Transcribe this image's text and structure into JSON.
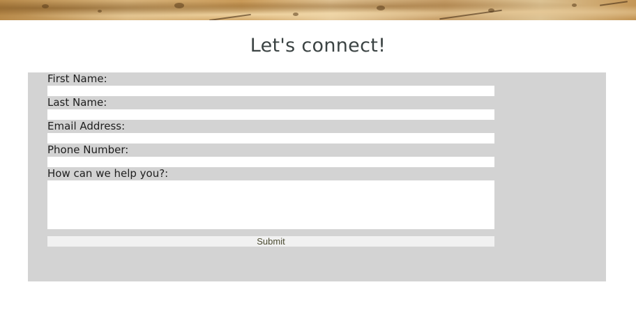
{
  "page": {
    "title": "Let's connect!"
  },
  "form": {
    "first_name_label": "First Name:",
    "first_name_value": "",
    "last_name_label": "Last Name:",
    "last_name_value": "",
    "email_label": "Email Address:",
    "email_value": "",
    "phone_label": "Phone Number:",
    "phone_value": "",
    "message_label": "How can we help you?:",
    "message_value": "",
    "submit_label": "Submit"
  },
  "colors": {
    "panel_background": "#d3d3d3",
    "title_text": "#3b4343",
    "input_background": "#ffffff",
    "submit_background": "#f1f1f1"
  }
}
